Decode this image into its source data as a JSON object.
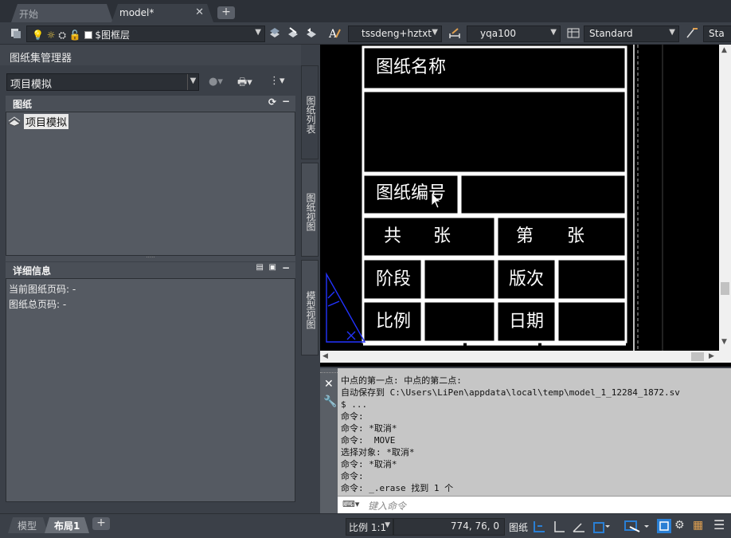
{
  "file_tabs": [
    {
      "label": "开始",
      "active": false
    },
    {
      "label": "model*",
      "active": true
    }
  ],
  "toolbar": {
    "layer_name": "$图框层",
    "text_style": "tssdeng+hztxt",
    "dim_style": "yqa100",
    "table_style": "Standard",
    "mleader_style": "Sta"
  },
  "ssm": {
    "title": "图纸集管理器",
    "project_select": "项目模拟",
    "sheets_header": "图纸",
    "tree_item": "项目模拟",
    "details_header": "详细信息",
    "details": [
      "当前图纸页码: -",
      "图纸总页码: -"
    ],
    "side_tabs": [
      "图纸列表",
      "图纸视图",
      "模型视图"
    ]
  },
  "drawing": {
    "cells": [
      "图纸名称",
      "图纸编号",
      "共",
      "张",
      "第",
      "张",
      "阶段",
      "版次",
      "比例",
      "日期"
    ]
  },
  "command": {
    "history": [
      "中点的第一点: 中点的第二点:",
      "自动保存到 C:\\Users\\LiPen\\appdata\\local\\temp\\model_1_12284_1872.sv",
      "$ ...",
      "命令:",
      "命令: *取消*",
      "命令:  MOVE",
      "选择对象: *取消*",
      "命令: *取消*",
      "命令:",
      "命令: _.erase 找到 1 个"
    ],
    "placeholder": "键入命令"
  },
  "status": {
    "layout_tabs": [
      "模型",
      "布局1"
    ],
    "scale": "比例 1:1",
    "coords": "774, 76, 0",
    "space": "图纸"
  },
  "colors": {
    "ui_bg": "#3b4048",
    "canvas_bg": "#000000",
    "accent_blue": "#2a7fd4",
    "ucs_blue": "#2233ff"
  }
}
